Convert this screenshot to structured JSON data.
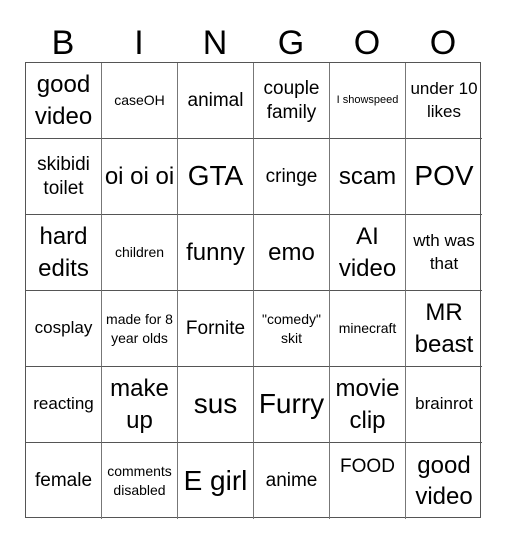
{
  "header": {
    "letters": [
      "B",
      "I",
      "N",
      "G",
      "O",
      "O"
    ]
  },
  "cells": [
    {
      "text": "good video",
      "size": "l"
    },
    {
      "text": "caseOH",
      "size": "s"
    },
    {
      "text": "animal",
      "size": "ml"
    },
    {
      "text": "couple family",
      "size": "ml"
    },
    {
      "text": "I showspeed",
      "size": "xs"
    },
    {
      "text": "under 10 likes",
      "size": "m"
    },
    {
      "text": "skibidi toilet",
      "size": "ml"
    },
    {
      "text": "oi oi oi",
      "size": "l"
    },
    {
      "text": "GTA",
      "size": "xl"
    },
    {
      "text": "cringe",
      "size": "ml"
    },
    {
      "text": "scam",
      "size": "l"
    },
    {
      "text": "POV",
      "size": "xl"
    },
    {
      "text": "hard edits",
      "size": "l"
    },
    {
      "text": "children",
      "size": "s"
    },
    {
      "text": "funny",
      "size": "l"
    },
    {
      "text": "emo",
      "size": "l"
    },
    {
      "text": "AI video",
      "size": "l"
    },
    {
      "text": "wth was that",
      "size": "m"
    },
    {
      "text": "cosplay",
      "size": "m"
    },
    {
      "text": "made for 8 year olds",
      "size": "s"
    },
    {
      "text": "Fornite",
      "size": "ml"
    },
    {
      "text": "\"comedy\" skit",
      "size": "s"
    },
    {
      "text": "minecraft",
      "size": "s"
    },
    {
      "text": "MR beast",
      "size": "l"
    },
    {
      "text": "reacting",
      "size": "m"
    },
    {
      "text": "make up",
      "size": "l"
    },
    {
      "text": "sus",
      "size": "xl"
    },
    {
      "text": "Furry",
      "size": "xl"
    },
    {
      "text": "movie clip",
      "size": "l"
    },
    {
      "text": "brainrot",
      "size": "m"
    },
    {
      "text": "female",
      "size": "ml"
    },
    {
      "text": "comments disabled",
      "size": "s"
    },
    {
      "text": "E girl",
      "size": "xl"
    },
    {
      "text": "anime",
      "size": "ml"
    },
    {
      "text": "FOOD",
      "size": "ml",
      "align": "top"
    },
    {
      "text": "good video",
      "size": "l"
    }
  ]
}
